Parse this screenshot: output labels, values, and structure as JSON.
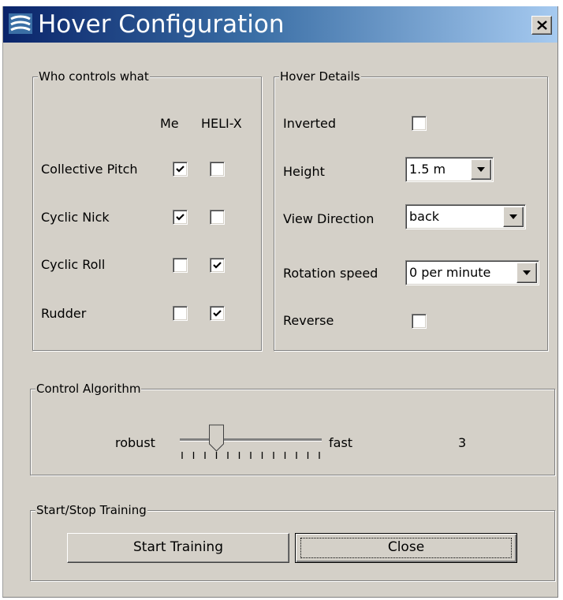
{
  "window": {
    "title": "Hover Configuration",
    "close_symbol": "x"
  },
  "who_controls": {
    "legend": "Who controls what",
    "col_me": "Me",
    "col_helix": "HELI-X",
    "rows": [
      {
        "label": "Collective Pitch",
        "me": true,
        "helix": false
      },
      {
        "label": "Cyclic Nick",
        "me": true,
        "helix": false
      },
      {
        "label": "Cyclic Roll",
        "me": false,
        "helix": true
      },
      {
        "label": "Rudder",
        "me": false,
        "helix": true
      }
    ]
  },
  "hover_details": {
    "legend": "Hover Details",
    "inverted_label": "Inverted",
    "inverted": false,
    "height_label": "Height",
    "height_value": "1.5 m",
    "view_direction_label": "View Direction",
    "view_direction_value": "back",
    "rotation_label": "Rotation speed",
    "rotation_value": "0 per minute",
    "reverse_label": "Reverse",
    "reverse": false
  },
  "control_algorithm": {
    "legend": "Control Algorithm",
    "min_label": "robust",
    "max_label": "fast",
    "value_text": "3",
    "slider_value": 3,
    "slider_min": 0,
    "slider_max": 12
  },
  "training": {
    "legend": "Start/Stop Training",
    "start_label": "Start Training",
    "close_label": "Close"
  },
  "icons": {
    "app": "helix-logo-icon",
    "close": "close-icon",
    "check": "checkmark-icon",
    "dropdown": "dropdown-arrow-icon",
    "slider": "slider-thumb-icon"
  }
}
